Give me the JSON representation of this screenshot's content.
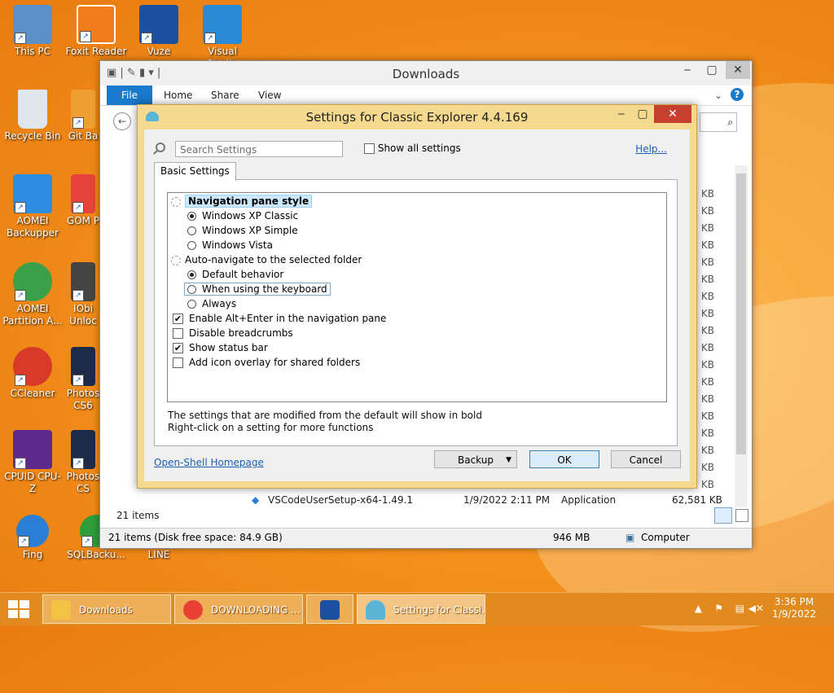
{
  "desktop": {
    "icons": [
      {
        "label": "This PC"
      },
      {
        "label": "Foxit Reader"
      },
      {
        "label": "Vuze"
      },
      {
        "label": "Visual Studio"
      },
      {
        "label": "Recycle Bin"
      },
      {
        "label": "Git Ba"
      },
      {
        "label": "AOMEI Backupper"
      },
      {
        "label": "GOM P"
      },
      {
        "label": "AOMEI Partition A..."
      },
      {
        "label": "IObi Unloc"
      },
      {
        "label": "CCleaner"
      },
      {
        "label": "Photos CS6"
      },
      {
        "label": "CPUID CPU-Z"
      },
      {
        "label": "Photos CS"
      },
      {
        "label": "Fing"
      },
      {
        "label": "SQLBacku..."
      },
      {
        "label": "LINE"
      }
    ]
  },
  "explorer": {
    "title": "Downloads",
    "ribbon_tabs": [
      "File",
      "Home",
      "Share",
      "View"
    ],
    "size_unit": "KB",
    "last_row": {
      "name": "VSCodeUserSetup-x64-1.49.1",
      "date": "1/9/2022 2:11 PM",
      "type": "Application",
      "size": "62,581 KB"
    },
    "item_count": "21 items",
    "status": {
      "items": "21 items (Disk free space: 84.9 GB)",
      "size": "946 MB",
      "location": "Computer"
    }
  },
  "dialog": {
    "title": "Settings for Classic Explorer 4.4.169",
    "search_placeholder": "Search Settings",
    "show_all_label": "Show all settings",
    "help_label": "Help...",
    "tab_label": "Basic Settings",
    "settings": {
      "nav_style": "Navigation pane style",
      "xp_classic": "Windows XP Classic",
      "xp_simple": "Windows XP Simple",
      "vista": "Windows Vista",
      "auto_nav": "Auto-navigate to the selected folder",
      "default_behavior": "Default behavior",
      "keyboard": "When using the keyboard",
      "always": "Always",
      "alt_enter": "Enable Alt+Enter in the navigation pane",
      "breadcrumbs": "Disable breadcrumbs",
      "status_bar": "Show status bar",
      "icon_overlay": "Add icon overlay for shared folders"
    },
    "note_line1": "The settings that are modified from the default will show in bold",
    "note_line2": "Right-click on a setting for more functions",
    "homepage_label": "Open-Shell Homepage",
    "backup_label": "Backup",
    "ok_label": "OK",
    "cancel_label": "Cancel"
  },
  "taskbar": {
    "items": [
      {
        "label": "Downloads"
      },
      {
        "label": "DOWNLOADING ..."
      },
      {
        "label": ""
      },
      {
        "label": "Settings for Classi..."
      }
    ],
    "time": "3:36 PM",
    "date": "1/9/2022"
  }
}
